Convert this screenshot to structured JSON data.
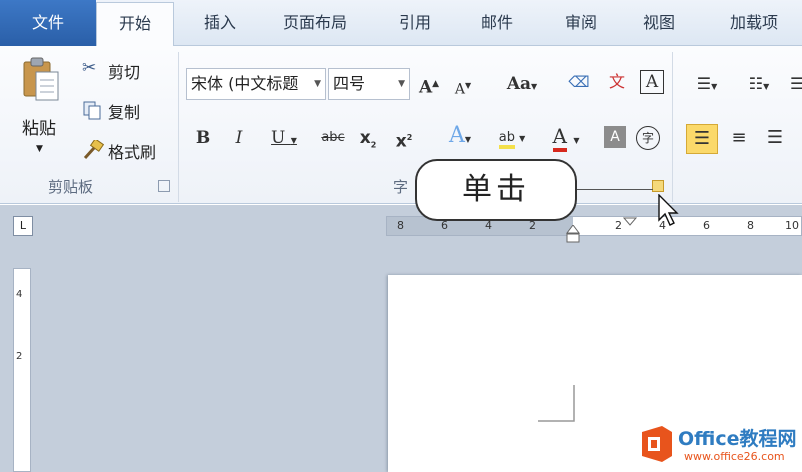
{
  "tabs": [
    "文件",
    "开始",
    "插入",
    "页面布局",
    "引用",
    "邮件",
    "审阅",
    "视图",
    "加载项"
  ],
  "clipboard": {
    "paste": "粘贴",
    "cut": "剪切",
    "copy": "复制",
    "format_painter": "格式刷",
    "group_label": "剪贴板"
  },
  "font": {
    "font_name": "宋体 (中文标题",
    "font_size": "四号",
    "group_label": "字"
  },
  "callout": {
    "text": "单击"
  },
  "ruler": {
    "h_ticks": [
      "8",
      "6",
      "4",
      "2",
      "2",
      "4",
      "6",
      "8",
      "10"
    ],
    "v_ticks": [
      "4",
      "2"
    ]
  },
  "watermark": {
    "brand": "Office教程网",
    "url": "www.office26.com"
  },
  "colors": {
    "file_tab": "#2a5fa8",
    "ribbon_bg": "#f5f8fc",
    "workspace": "#c4cedb",
    "accent_highlight": "#fbd96a",
    "font_color_red": "#d6281d"
  }
}
